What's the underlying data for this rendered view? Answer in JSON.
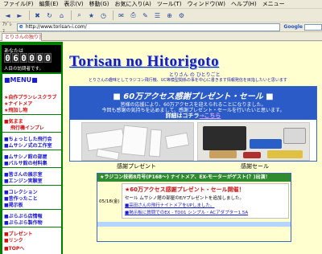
{
  "browser": {
    "menu": [
      "ファイル(F)",
      "編集(E)",
      "表示(V)",
      "移動(G)",
      "お気に入り(A)",
      "ツール(T)",
      "ウィンドウ(W)",
      "ヘルプ(H)",
      "メニュー"
    ],
    "address_label": "ｱﾄﾞﾚｽ",
    "address": "http://www.torisan-i.com/",
    "google_label": "Google",
    "tab_title": "とりさんの独り言"
  },
  "sidebar": {
    "counter_caption": "あなたは",
    "counter_digits": [
      "0",
      "6",
      "0",
      "0",
      "0",
      "0"
    ],
    "counter_sub": "人目の訪問者です。",
    "menu_title": "■MENU■",
    "items": [
      {
        "label": "★自作プランレスクラブ",
        "color": "red"
      },
      {
        "label": "★ナイトメア",
        "color": "red"
      },
      {
        "label": "★飛加し物",
        "color": "red"
      },
      {
        "label": "■気まま",
        "color": "red"
      },
      {
        "label": "飛行機インプレ",
        "color": "red"
      },
      {
        "label": "■ちょっとした飛行会",
        "color": "blue"
      },
      {
        "label": "■ムサシノ式の工作室",
        "color": "blue"
      },
      {
        "label": "■ムサシノ館の部屋",
        "color": "blue"
      },
      {
        "label": "■バルサ館の材料集",
        "color": "blue"
      },
      {
        "label": "■皆さんの展示室",
        "color": "blue"
      },
      {
        "label": "■エンジン実験室",
        "color": "blue"
      },
      {
        "label": "■コレクション",
        "color": "blue"
      },
      {
        "label": "■昔作ったこと",
        "color": "blue"
      },
      {
        "label": "■掲示板",
        "color": "blue"
      },
      {
        "label": "■ぶらぶら店情報",
        "color": "blue"
      },
      {
        "label": "■ぶらぶら製作物",
        "color": "blue"
      },
      {
        "label": "■プレゼント",
        "color": "red"
      },
      {
        "label": "■リンク",
        "color": "red"
      },
      {
        "label": "■TOPへ",
        "color": "red"
      }
    ]
  },
  "main": {
    "banner": "Torisan no Hitorigoto",
    "subtitle": "とりさん の ひとりごと",
    "tagline": "とりさんの趣味としてラジコン飛行機、UC等模型関係の事を中心に書きます情報発信を目指したいと思います",
    "promo": {
      "title": "■ 60万アクセス感謝プレゼント・セール ■",
      "line1": "皆様の応援により、60万アクセスを迎えられることになりました。",
      "line2": "今回も感謝の気持ちを込めまして、感謝プレゼント・セールを行いたいと思います。",
      "detail_prefix": "詳細はコチラ",
      "detail_link": "→こちら",
      "caption_left": "感謝プレゼント",
      "caption_right": "感謝セール"
    },
    "notice": {
      "header": "★ラジコン技術8月号(P168〜) ナイトメア、EX-モーターがゲスト(？)出演！",
      "date": "05/18(金)",
      "title": "★60万アクセス感謝プレゼント・セール開催！",
      "lines": [
        "セール ムサシノ館の部屋のE/Yプレゼントを追加しました。",
        "■高田さんの飛行ナイトメアをUPしました。",
        "■掲示板に質問でのEX - TD01 シンプル・ACアダプター1.5A"
      ]
    }
  }
}
